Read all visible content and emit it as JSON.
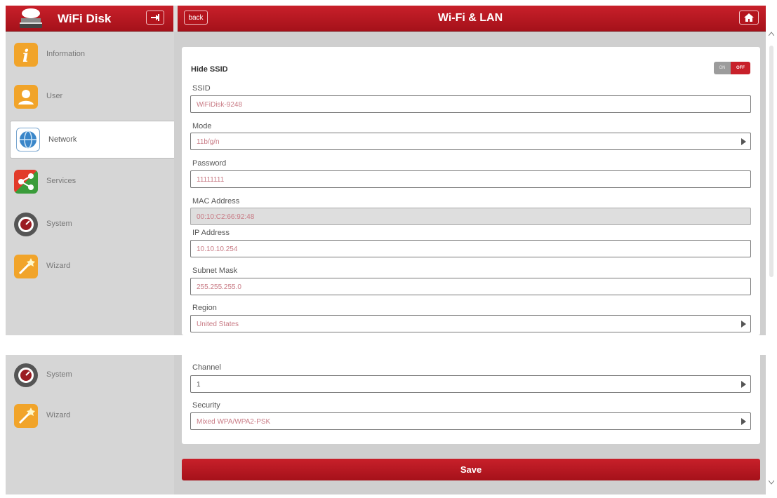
{
  "header": {
    "app_title": "WiFi Disk",
    "back_label": "back",
    "page_title": "Wi-Fi & LAN"
  },
  "sidebar": {
    "items": [
      {
        "label": "Information"
      },
      {
        "label": "User"
      },
      {
        "label": "Network"
      },
      {
        "label": "Services"
      },
      {
        "label": "System"
      },
      {
        "label": "Wizard"
      }
    ],
    "items_lower": [
      {
        "label": "System"
      },
      {
        "label": "Wizard"
      }
    ],
    "active": "Network"
  },
  "form": {
    "hide_ssid": {
      "label": "Hide SSID",
      "on_label": "ON",
      "off_label": "OFF",
      "state": "OFF"
    },
    "ssid": {
      "label": "SSID",
      "value": "WiFiDisk-9248"
    },
    "mode": {
      "label": "Mode",
      "value": "11b/g/n"
    },
    "password": {
      "label": "Password",
      "value": "11111111"
    },
    "mac": {
      "label": "MAC Address",
      "value": "00:10:C2:66:92:48"
    },
    "ip": {
      "label": "IP Address",
      "value": "10.10.10.254"
    },
    "subnet": {
      "label": "Subnet Mask",
      "value": "255.255.255.0"
    },
    "region": {
      "label": "Region",
      "value": "United States"
    },
    "channel": {
      "label": "Channel",
      "value": "1"
    },
    "security": {
      "label": "Security",
      "value": "Mixed WPA/WPA2-PSK"
    }
  },
  "save_label": "Save",
  "colors": {
    "brand_red": "#c8202a",
    "sidebar_bg": "#d6d6d6",
    "field_text": "#c87a84"
  }
}
